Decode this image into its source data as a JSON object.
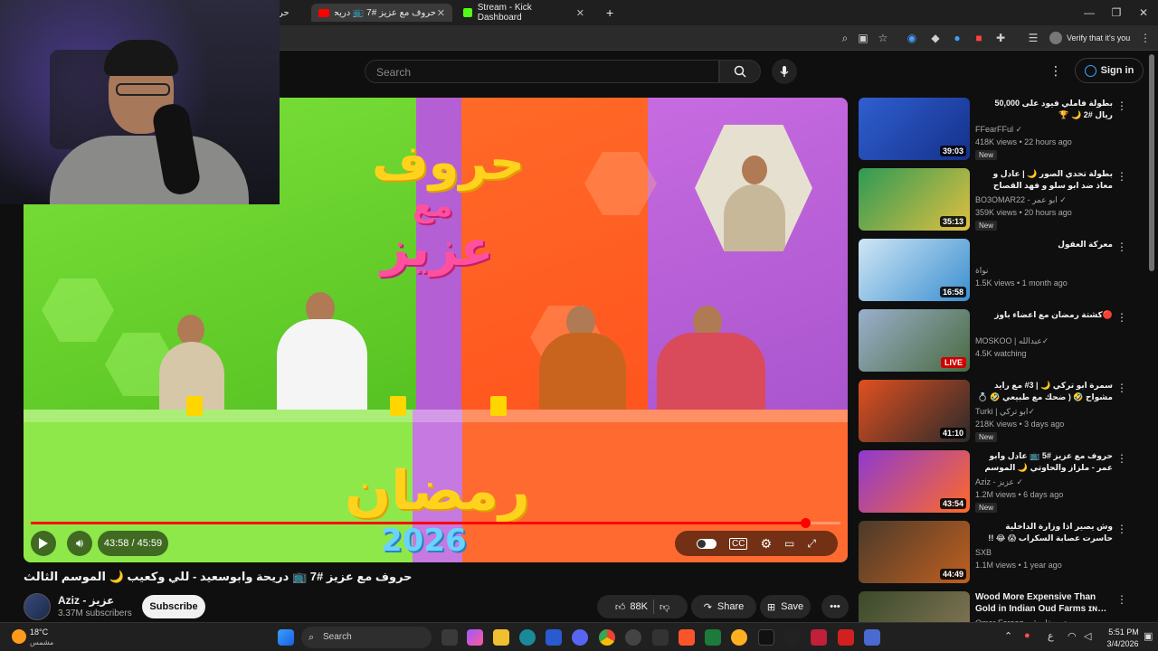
{
  "browser": {
    "tabs": [
      {
        "label": "حر",
        "active": false
      },
      {
        "label": "حروف مع عزيز #7 📺 دريحة وابو…",
        "active": true
      },
      {
        "label": "Stream - Kick Dashboard",
        "active": false
      }
    ],
    "new_tab_label": "+",
    "verify_label": "Verify that it's you"
  },
  "youtube": {
    "search_placeholder": "Search",
    "signin_label": "Sign in",
    "video": {
      "title": "حروف مع عزيز #7 📺 دريحة وابوسعيد - للي وكعيب 🌙 الموسم الثالث",
      "time_current": "43:58",
      "time_sep": " / ",
      "time_total": "45:59",
      "progress": 0.956,
      "show_logo_top": "حروف",
      "show_logo_mid": "مع",
      "show_logo_bottom": "عزيز",
      "ramadan_text": "رمضان",
      "year_text": "2026"
    },
    "channel": {
      "name": "Aziz - عزيز",
      "subscribers": "3.37M subscribers",
      "subscribe_label": "Subscribe"
    },
    "actions": {
      "likes": "88K",
      "share_label": "Share",
      "save_label": "Save"
    },
    "recommendations": [
      {
        "title": "بطولة فاملي فيود على 50,000 ريال #2 🌙 🏆",
        "channel": "FFearFFul ✓",
        "meta": "418K views • 22 hours ago",
        "badge": "New",
        "duration": "39:03",
        "colors": [
          "#2f5fd0",
          "#15308a"
        ],
        "ltr": false
      },
      {
        "title": "بطولة تحدي الصور 🌙 | عادل و معاذ ضد ابو سلو و فهد القصاح",
        "channel": "BO3OMAR22 - ابو عمر ✓",
        "meta": "359K views • 20 hours ago",
        "badge": "New",
        "duration": "35:13",
        "colors": [
          "#2e9a55",
          "#e0c040"
        ],
        "ltr": false
      },
      {
        "title": "معركة العقول",
        "channel": "نواة",
        "meta": "1.5K views • 1 month ago",
        "badge": "",
        "duration": "16:58",
        "colors": [
          "#cfe6f5",
          "#3b8fd0"
        ],
        "ltr": false
      },
      {
        "title": "🔴كشتة رمضان مع اعضاء باوز",
        "channel": "MOSKOO | عبدالله✓",
        "meta": "4.5K watching",
        "badge": "",
        "duration": "LIVE",
        "colors": [
          "#9ab0cc",
          "#4a6a40"
        ],
        "ltr": false
      },
      {
        "title": "سمرة ابو تركي 🌙 | 3# مع رايد مشواح 🤣 ( ضحك مع طبيعي 🤣 💍🔥 !! )",
        "channel": "Turki | ابو تركي✓",
        "meta": "218K views • 3 days ago",
        "badge": "New",
        "duration": "41:10",
        "colors": [
          "#e05020",
          "#2a2a2a"
        ],
        "ltr": false
      },
      {
        "title": "حروف مع عزيز #5 📺 عادل وابو عمر - ملزاز والحاوتي 🌙 الموسم الثالث",
        "channel": "Aziz - عزيز ✓",
        "meta": "1.2M views • 6 days ago",
        "badge": "New",
        "duration": "43:54",
        "colors": [
          "#8e3ad0",
          "#ff6a28"
        ],
        "ltr": false
      },
      {
        "title": "وش يصير اذا وزارة الداخلية حاسرت عصابة السكراب 😱 😂 !!",
        "channel": "SXB",
        "meta": "1.1M views • 1 year ago",
        "badge": "",
        "duration": "44:49",
        "colors": [
          "#4a3a2a",
          "#c06020"
        ],
        "ltr": false
      },
      {
        "title": "Wood More Expensive Than Gold in Indian Oud Farms ɪɴ…",
        "channel": "Omar Farooq - عمر فاروق",
        "meta": "",
        "badge": "",
        "duration": "",
        "colors": [
          "#3a4a2a",
          "#8a7a5a"
        ],
        "ltr": true
      }
    ]
  },
  "taskbar": {
    "weather_temp": "18°C",
    "weather_desc": "مشمس",
    "search_label": "Search",
    "language": "ع",
    "time": "5:51 PM",
    "date": "3/4/2026"
  },
  "colors": {
    "accent_red": "#ff0000",
    "yt_bg": "#0f0f0f",
    "green_panel": "#6ad62a",
    "orange_panel": "#ff5a20",
    "purple_panel": "#b45fd3"
  }
}
